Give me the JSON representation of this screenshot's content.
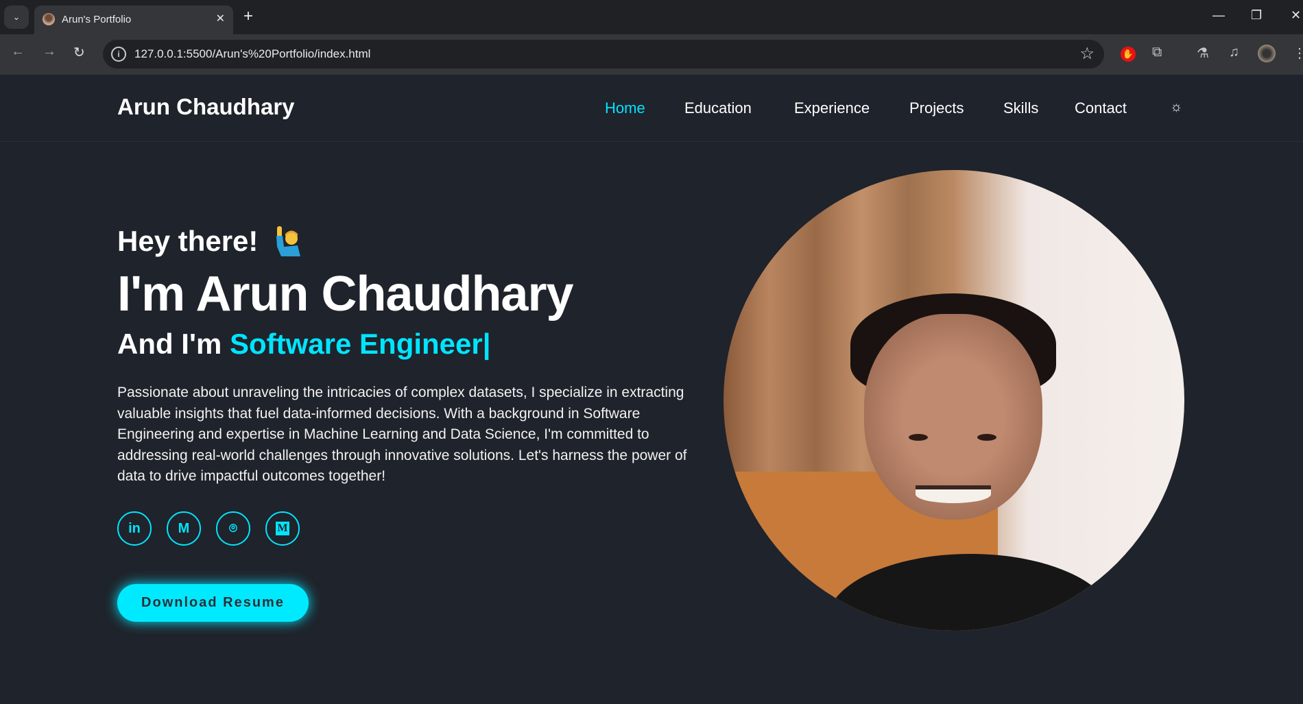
{
  "browser": {
    "tab_title": "Arun's Portfolio",
    "url": "127.0.0.1:5500/Arun's%20Portfolio/index.html"
  },
  "header": {
    "logo": "Arun Chaudhary",
    "nav": [
      "Home",
      "Education",
      "Experience",
      "Projects",
      "Skills",
      "Contact"
    ],
    "active": "Home",
    "theme_icon": "sun-icon"
  },
  "hero": {
    "greeting": "Hey there!",
    "greeting_emoji": "🙋‍♂️",
    "name": "I'm Arun Chaudhary",
    "role_prefix": "And I'm",
    "role": "Software Engineer|",
    "bio": "Passionate about unraveling the intricacies of complex datasets, I specialize in extracting valuable insights that fuel data-informed decisions. With a background in Software Engineering and expertise in Machine Learning and Data Science, I'm committed to addressing real-world challenges through innovative solutions. Let's harness the power of data to drive impactful outcomes together!",
    "socials": [
      {
        "icon": "linkedin-icon",
        "glyph": "in"
      },
      {
        "icon": "gmail-icon",
        "glyph": "M"
      },
      {
        "icon": "github-icon",
        "glyph": "⌾"
      },
      {
        "icon": "medium-icon",
        "glyph": "M"
      }
    ],
    "download_label": "Download Resume"
  },
  "colors": {
    "accent": "#00e5ff",
    "background": "#1f232b"
  }
}
